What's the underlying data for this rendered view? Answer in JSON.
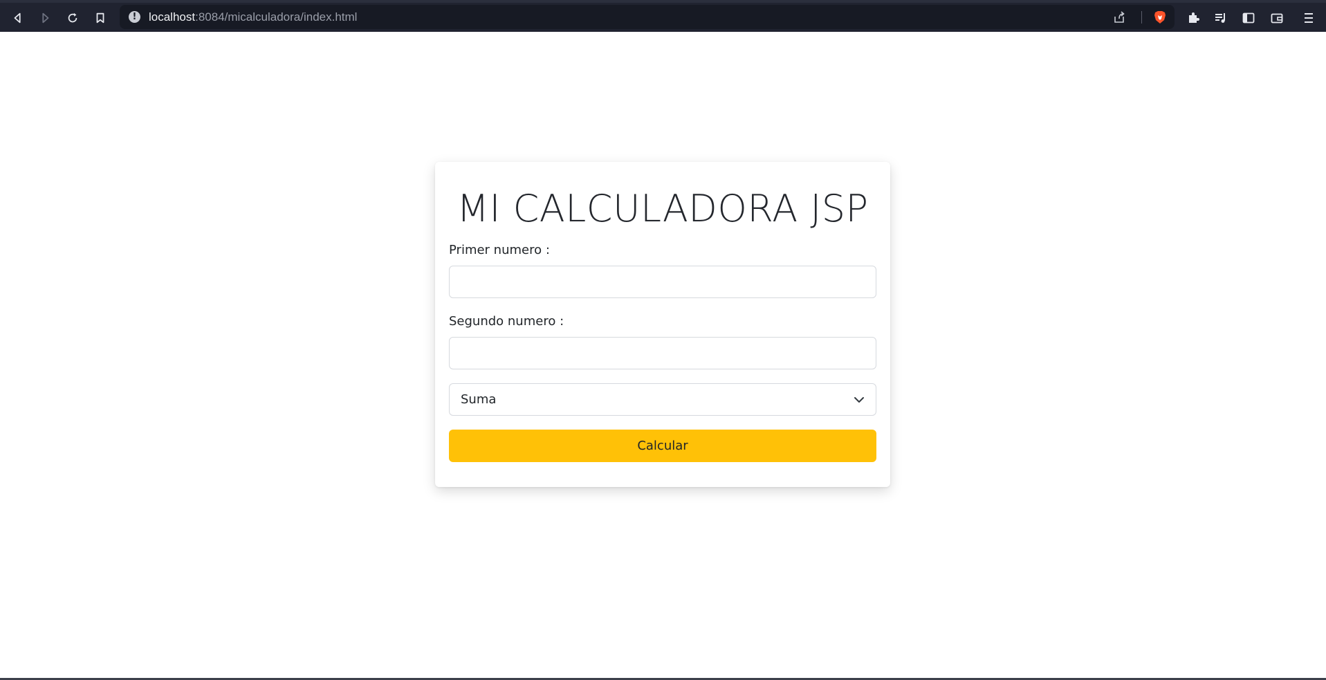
{
  "browser": {
    "url_host": "localhost",
    "url_rest": ":8084/micalculadora/index.html",
    "icons": {
      "back": "back-arrow-icon",
      "forward": "forward-arrow-icon",
      "reload": "reload-icon",
      "bookmark": "bookmark-icon",
      "site_info": "info-icon",
      "share": "share-icon",
      "brave": "brave-shields-icon",
      "extensions": "puzzle-icon",
      "playlist": "playlist-icon",
      "sidebar": "sidebar-icon",
      "wallet": "wallet-icon",
      "menu": "menu-icon"
    },
    "colors": {
      "toolbar_bg": "#202330",
      "urlbar_bg": "#171a24"
    }
  },
  "card": {
    "title": "MI CALCULADORA JSP",
    "first_label": "Primer numero :",
    "first_value": "",
    "second_label": "Segundo numero :",
    "second_value": "",
    "operation_selected": "Suma",
    "submit_label": "Calcular",
    "submit_color": "#ffc107"
  }
}
